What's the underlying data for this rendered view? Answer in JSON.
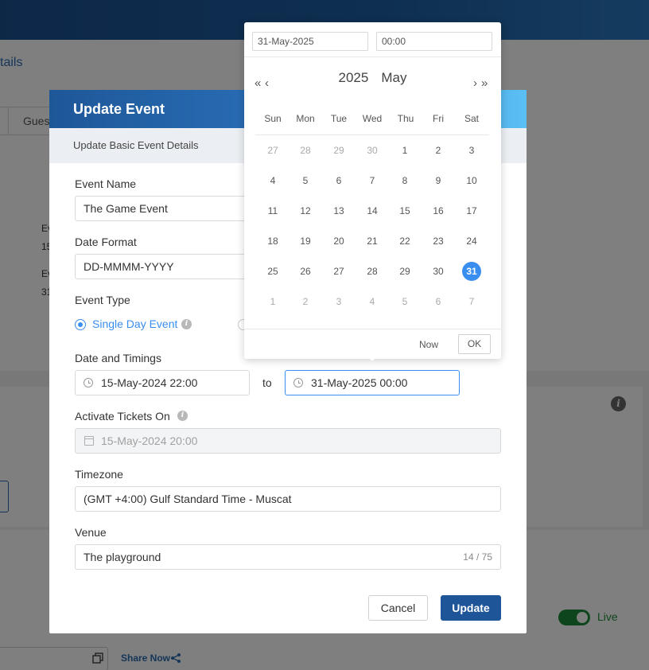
{
  "background": {
    "details_link": "tails",
    "tab_guest": "Guest",
    "event_line1": "Ev",
    "event_line2": "15",
    "event_line3": "Ev",
    "event_line4": "31",
    "live_label": "Live",
    "share_label": "Share Now",
    "colors": {
      "topbar": "#1d5fa3",
      "live": "#1f8a3a"
    }
  },
  "modal": {
    "title": "Update Event",
    "subtitle": "Update Basic Event Details",
    "event_name": {
      "label": "Event Name",
      "value": "The Game Event"
    },
    "date_format": {
      "label": "Date Format",
      "value": "DD-MMMM-YYYY"
    },
    "event_type": {
      "label": "Event Type",
      "selected_option": "Single Day Event"
    },
    "date_timings": {
      "label": "Date and Timings",
      "start": "15-May-2024 22:00",
      "separator": "to",
      "end": "31-May-2025 00:00"
    },
    "activate_tickets": {
      "label": "Activate Tickets On",
      "value": "15-May-2024 20:00"
    },
    "timezone": {
      "label": "Timezone",
      "value": "(GMT +4:00) Gulf Standard Time - Muscat"
    },
    "venue": {
      "label": "Venue",
      "value": "The playground",
      "counter": "14 / 75"
    },
    "cancel_label": "Cancel",
    "update_label": "Update",
    "colors": {
      "primary": "#1e5599",
      "accent": "#3a8ef0"
    }
  },
  "picker": {
    "date_input": "31-May-2025",
    "time_input": "00:00",
    "year": "2025",
    "month": "May",
    "nav_prev_year": "«",
    "nav_prev_month": "‹",
    "nav_next_month": "›",
    "nav_next_year": "»",
    "weekdays": [
      "Sun",
      "Mon",
      "Tue",
      "Wed",
      "Thu",
      "Fri",
      "Sat"
    ],
    "weeks": [
      [
        "27",
        "28",
        "29",
        "30",
        "1",
        "2",
        "3"
      ],
      [
        "4",
        "5",
        "6",
        "7",
        "8",
        "9",
        "10"
      ],
      [
        "11",
        "12",
        "13",
        "14",
        "15",
        "16",
        "17"
      ],
      [
        "18",
        "19",
        "20",
        "21",
        "22",
        "23",
        "24"
      ],
      [
        "25",
        "26",
        "27",
        "28",
        "29",
        "30",
        "31"
      ],
      [
        "1",
        "2",
        "3",
        "4",
        "5",
        "6",
        "7"
      ]
    ],
    "selected_day": "31",
    "now_label": "Now",
    "ok_label": "OK"
  }
}
